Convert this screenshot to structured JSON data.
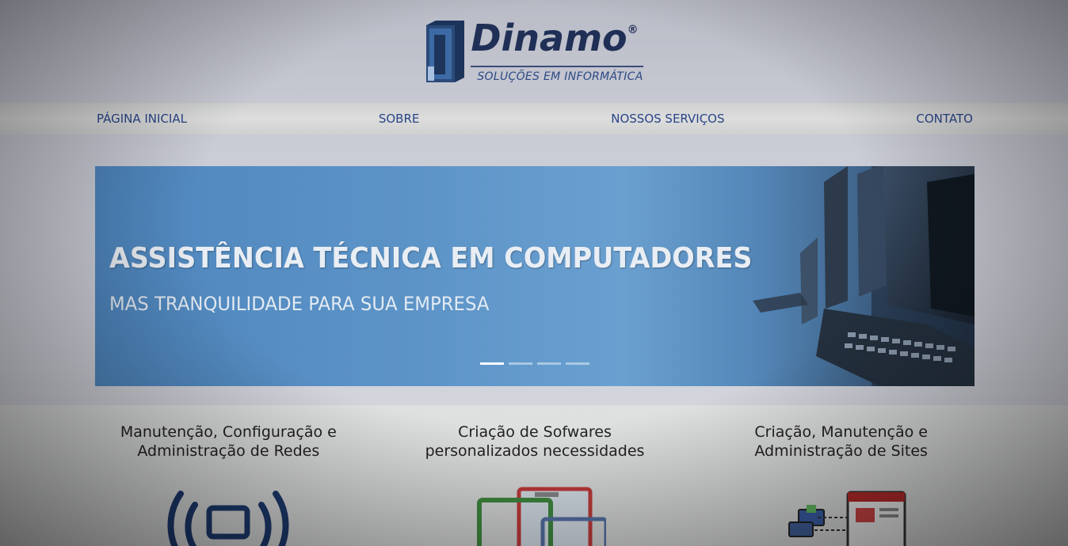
{
  "brand": {
    "name": "Dinamo",
    "registered": "®",
    "tagline": "SOLUÇÕES EM INFORMÁTICA"
  },
  "nav": {
    "items": [
      {
        "label": "PÁGINA INICIAL"
      },
      {
        "label": "SOBRE"
      },
      {
        "label": "NOSSOS SERVIÇOS"
      },
      {
        "label": "CONTATO"
      }
    ]
  },
  "banner": {
    "title": "ASSISTÊNCIA TÉCNICA EM COMPUTADORES",
    "subtitle": "MAS TRANQUILIDADE PARA SUA EMPRESA",
    "slides_total": 4,
    "active_slide": 1
  },
  "services": [
    {
      "title_line1": "Manutenção, Configuração e",
      "title_line2": "Administração de Redes",
      "icon": "wifi-monitor-icon"
    },
    {
      "title_line1": "Criação de Sofwares",
      "title_line2": "personalizados necessidades",
      "icon": "software-windows-icon"
    },
    {
      "title_line1": "Criação, Manutenção e",
      "title_line2": "Administração de Sites",
      "icon": "website-icon"
    }
  ],
  "colors": {
    "nav_text": "#2a4489",
    "brand_dark": "#1f2f55",
    "banner_blue": "#5c93c7"
  }
}
